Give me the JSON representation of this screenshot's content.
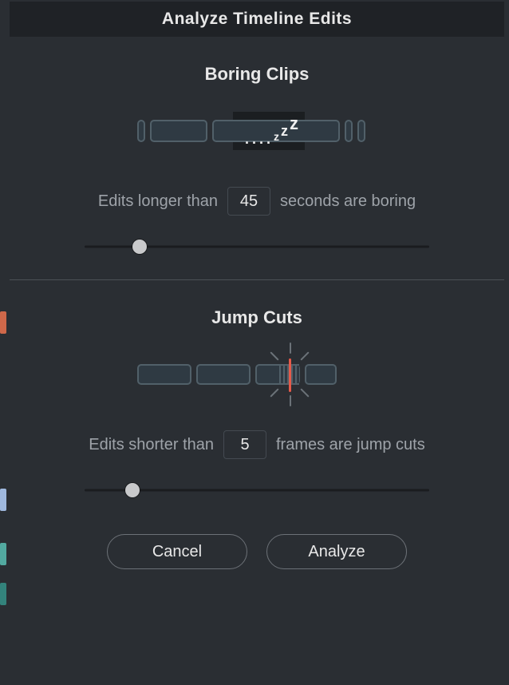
{
  "title": "Analyze Timeline Edits",
  "boring": {
    "heading": "Boring Clips",
    "sentence_pre": "Edits longer than",
    "value": "45",
    "sentence_post": "seconds are boring",
    "slider_pct": 16
  },
  "jumpcuts": {
    "heading": "Jump Cuts",
    "sentence_pre": "Edits shorter than",
    "value": "5",
    "sentence_post": "frames are jump cuts",
    "slider_pct": 14
  },
  "buttons": {
    "cancel": "Cancel",
    "analyze": "Analyze"
  }
}
